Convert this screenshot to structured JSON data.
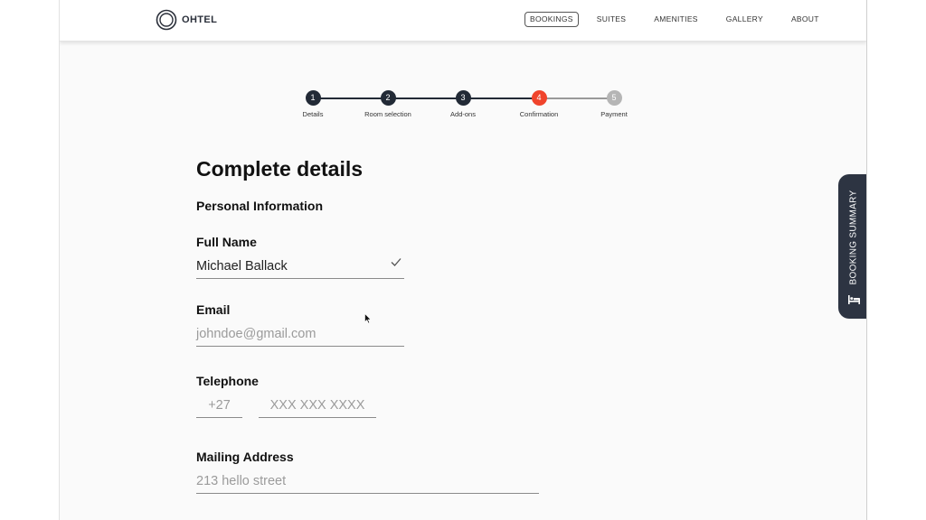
{
  "brand": {
    "name": "OHTEL"
  },
  "nav": {
    "links": [
      {
        "label": "BOOKINGS",
        "active": true
      },
      {
        "label": "SUITES"
      },
      {
        "label": "AMENITIES"
      },
      {
        "label": "GALLERY"
      },
      {
        "label": "ABOUT"
      }
    ]
  },
  "stepper": {
    "steps": [
      {
        "number": "1",
        "label": "Details",
        "state": "done"
      },
      {
        "number": "2",
        "label": "Room selection",
        "state": "done"
      },
      {
        "number": "3",
        "label": "Add-ons",
        "state": "done"
      },
      {
        "number": "4",
        "label": "Confirmation",
        "state": "current"
      },
      {
        "number": "5",
        "label": "Payment",
        "state": "pending"
      }
    ]
  },
  "form": {
    "title": "Complete details",
    "section_title": "Personal Information",
    "full_name": {
      "label": "Full Name",
      "value": "Michael Ballack"
    },
    "email": {
      "label": "Email",
      "placeholder": "johndoe@gmail.com"
    },
    "telephone": {
      "label": "Telephone",
      "code_placeholder": "+27",
      "number_placeholder": "XXX XXX XXXX"
    },
    "mailing_address": {
      "label": "Mailing Address",
      "placeholder": "213 hello street"
    }
  },
  "summary_tab": {
    "label": "BOOKING SUMMARY"
  },
  "colors": {
    "primary_dark": "#222a36",
    "accent_current_step": "#f0442c",
    "pending_step": "#b5b5b5",
    "summary_tab_bg": "#2d3442"
  },
  "icons": [
    "logo-rings-icon",
    "check-icon",
    "bed-icon",
    "mouse-cursor-icon"
  ]
}
